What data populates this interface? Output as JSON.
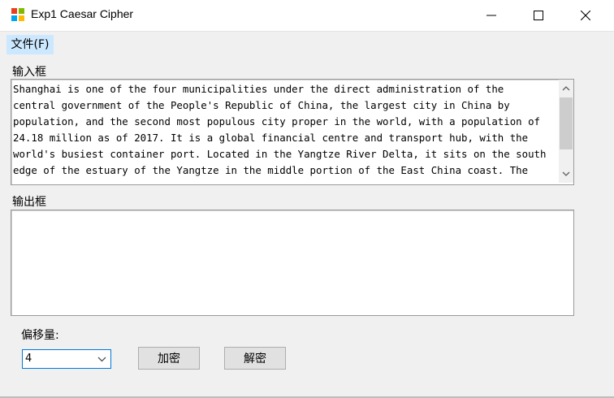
{
  "window": {
    "title": "Exp1 Caesar Cipher"
  },
  "menu": {
    "file_label": "文件(F)"
  },
  "input": {
    "label": "输入框",
    "text": "Shanghai is one of the four municipalities under the direct administration of the central government of the People's Republic of China, the largest city in China by population, and the second most populous city proper in the world, with a population of 24.18 million as of 2017. It is a global financial centre and transport hub, with the world's busiest container port. Located in the Yangtze River Delta, it sits on the south edge of the estuary of the Yangtze in the middle portion of the East China coast. The"
  },
  "output": {
    "label": "输出框",
    "text": ""
  },
  "offset": {
    "label": "偏移量:",
    "value": "4"
  },
  "buttons": {
    "encrypt": "加密",
    "decrypt": "解密"
  },
  "icons": {
    "app": "app-icon",
    "minimize": "minimize-icon",
    "maximize": "maximize-icon",
    "close": "close-icon",
    "scroll_up": "chevron-up-icon",
    "scroll_down": "chevron-down-icon",
    "dropdown": "chevron-down-icon"
  }
}
